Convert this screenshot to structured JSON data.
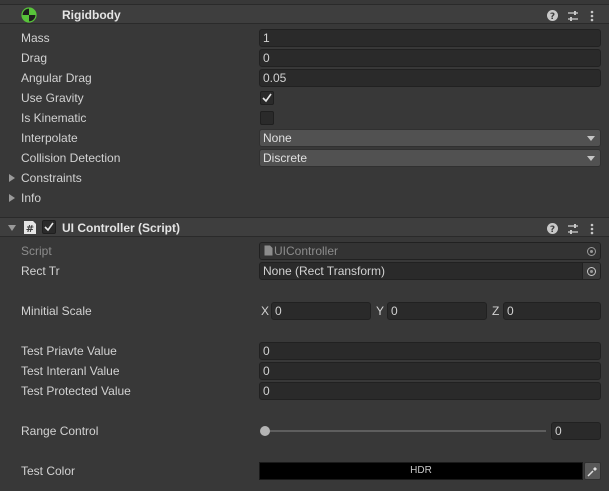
{
  "rigidbody": {
    "title": "Rigidbody",
    "mass_label": "Mass",
    "mass_value": "1",
    "drag_label": "Drag",
    "drag_value": "0",
    "angular_drag_label": "Angular Drag",
    "angular_drag_value": "0.05",
    "use_gravity_label": "Use Gravity",
    "use_gravity_checked": true,
    "is_kinematic_label": "Is Kinematic",
    "is_kinematic_checked": false,
    "interpolate_label": "Interpolate",
    "interpolate_value": "None",
    "collision_label": "Collision Detection",
    "collision_value": "Discrete",
    "constraints_label": "Constraints",
    "info_label": "Info"
  },
  "ui_controller": {
    "title": "UI Controller (Script)",
    "script_label": "Script",
    "script_value": "UIController",
    "rect_tr_label": "Rect Tr",
    "rect_tr_value": "None (Rect Transform)",
    "minitial_scale_label": "Minitial Scale",
    "x_label": "X",
    "x_value": "0",
    "y_label": "Y",
    "y_value": "0",
    "z_label": "Z",
    "z_value": "0",
    "priavte_label": "Test Priavte Value",
    "priavte_value": "0",
    "interanl_label": "Test Interanl Value",
    "interanl_value": "0",
    "protected_label": "Test Protected Value",
    "protected_value": "0",
    "range_label": "Range Control",
    "range_value": "0",
    "color_label": "Test Color",
    "color_badge": "HDR",
    "color_value": "#000000"
  },
  "icons": {
    "help": "?",
    "settings": "⇅",
    "more": "⋮"
  }
}
